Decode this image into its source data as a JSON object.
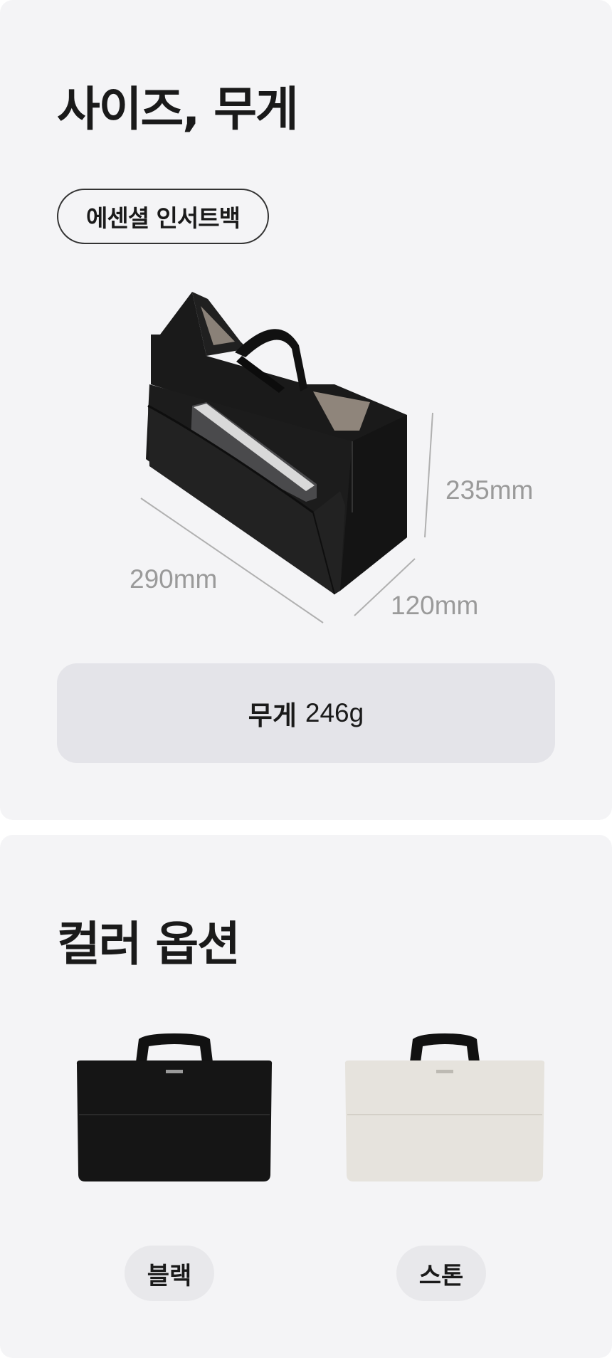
{
  "size_section": {
    "title": "사이즈, 무게",
    "product_name": "에센셜 인서트백",
    "dimensions": {
      "height": "235mm",
      "width": "290mm",
      "depth": "120mm"
    },
    "weight_label": "무게",
    "weight_value": "246g"
  },
  "color_section": {
    "title": "컬러 옵션",
    "options": [
      {
        "label": "블랙",
        "color": "#151515"
      },
      {
        "label": "스톤",
        "color": "#e6e3dd"
      }
    ]
  },
  "colors": {
    "card_bg": "#f4f4f6",
    "weight_box_bg": "#e4e4e9",
    "dimension_text": "#9a9a9a",
    "chip_bg": "#e8e8eb"
  }
}
